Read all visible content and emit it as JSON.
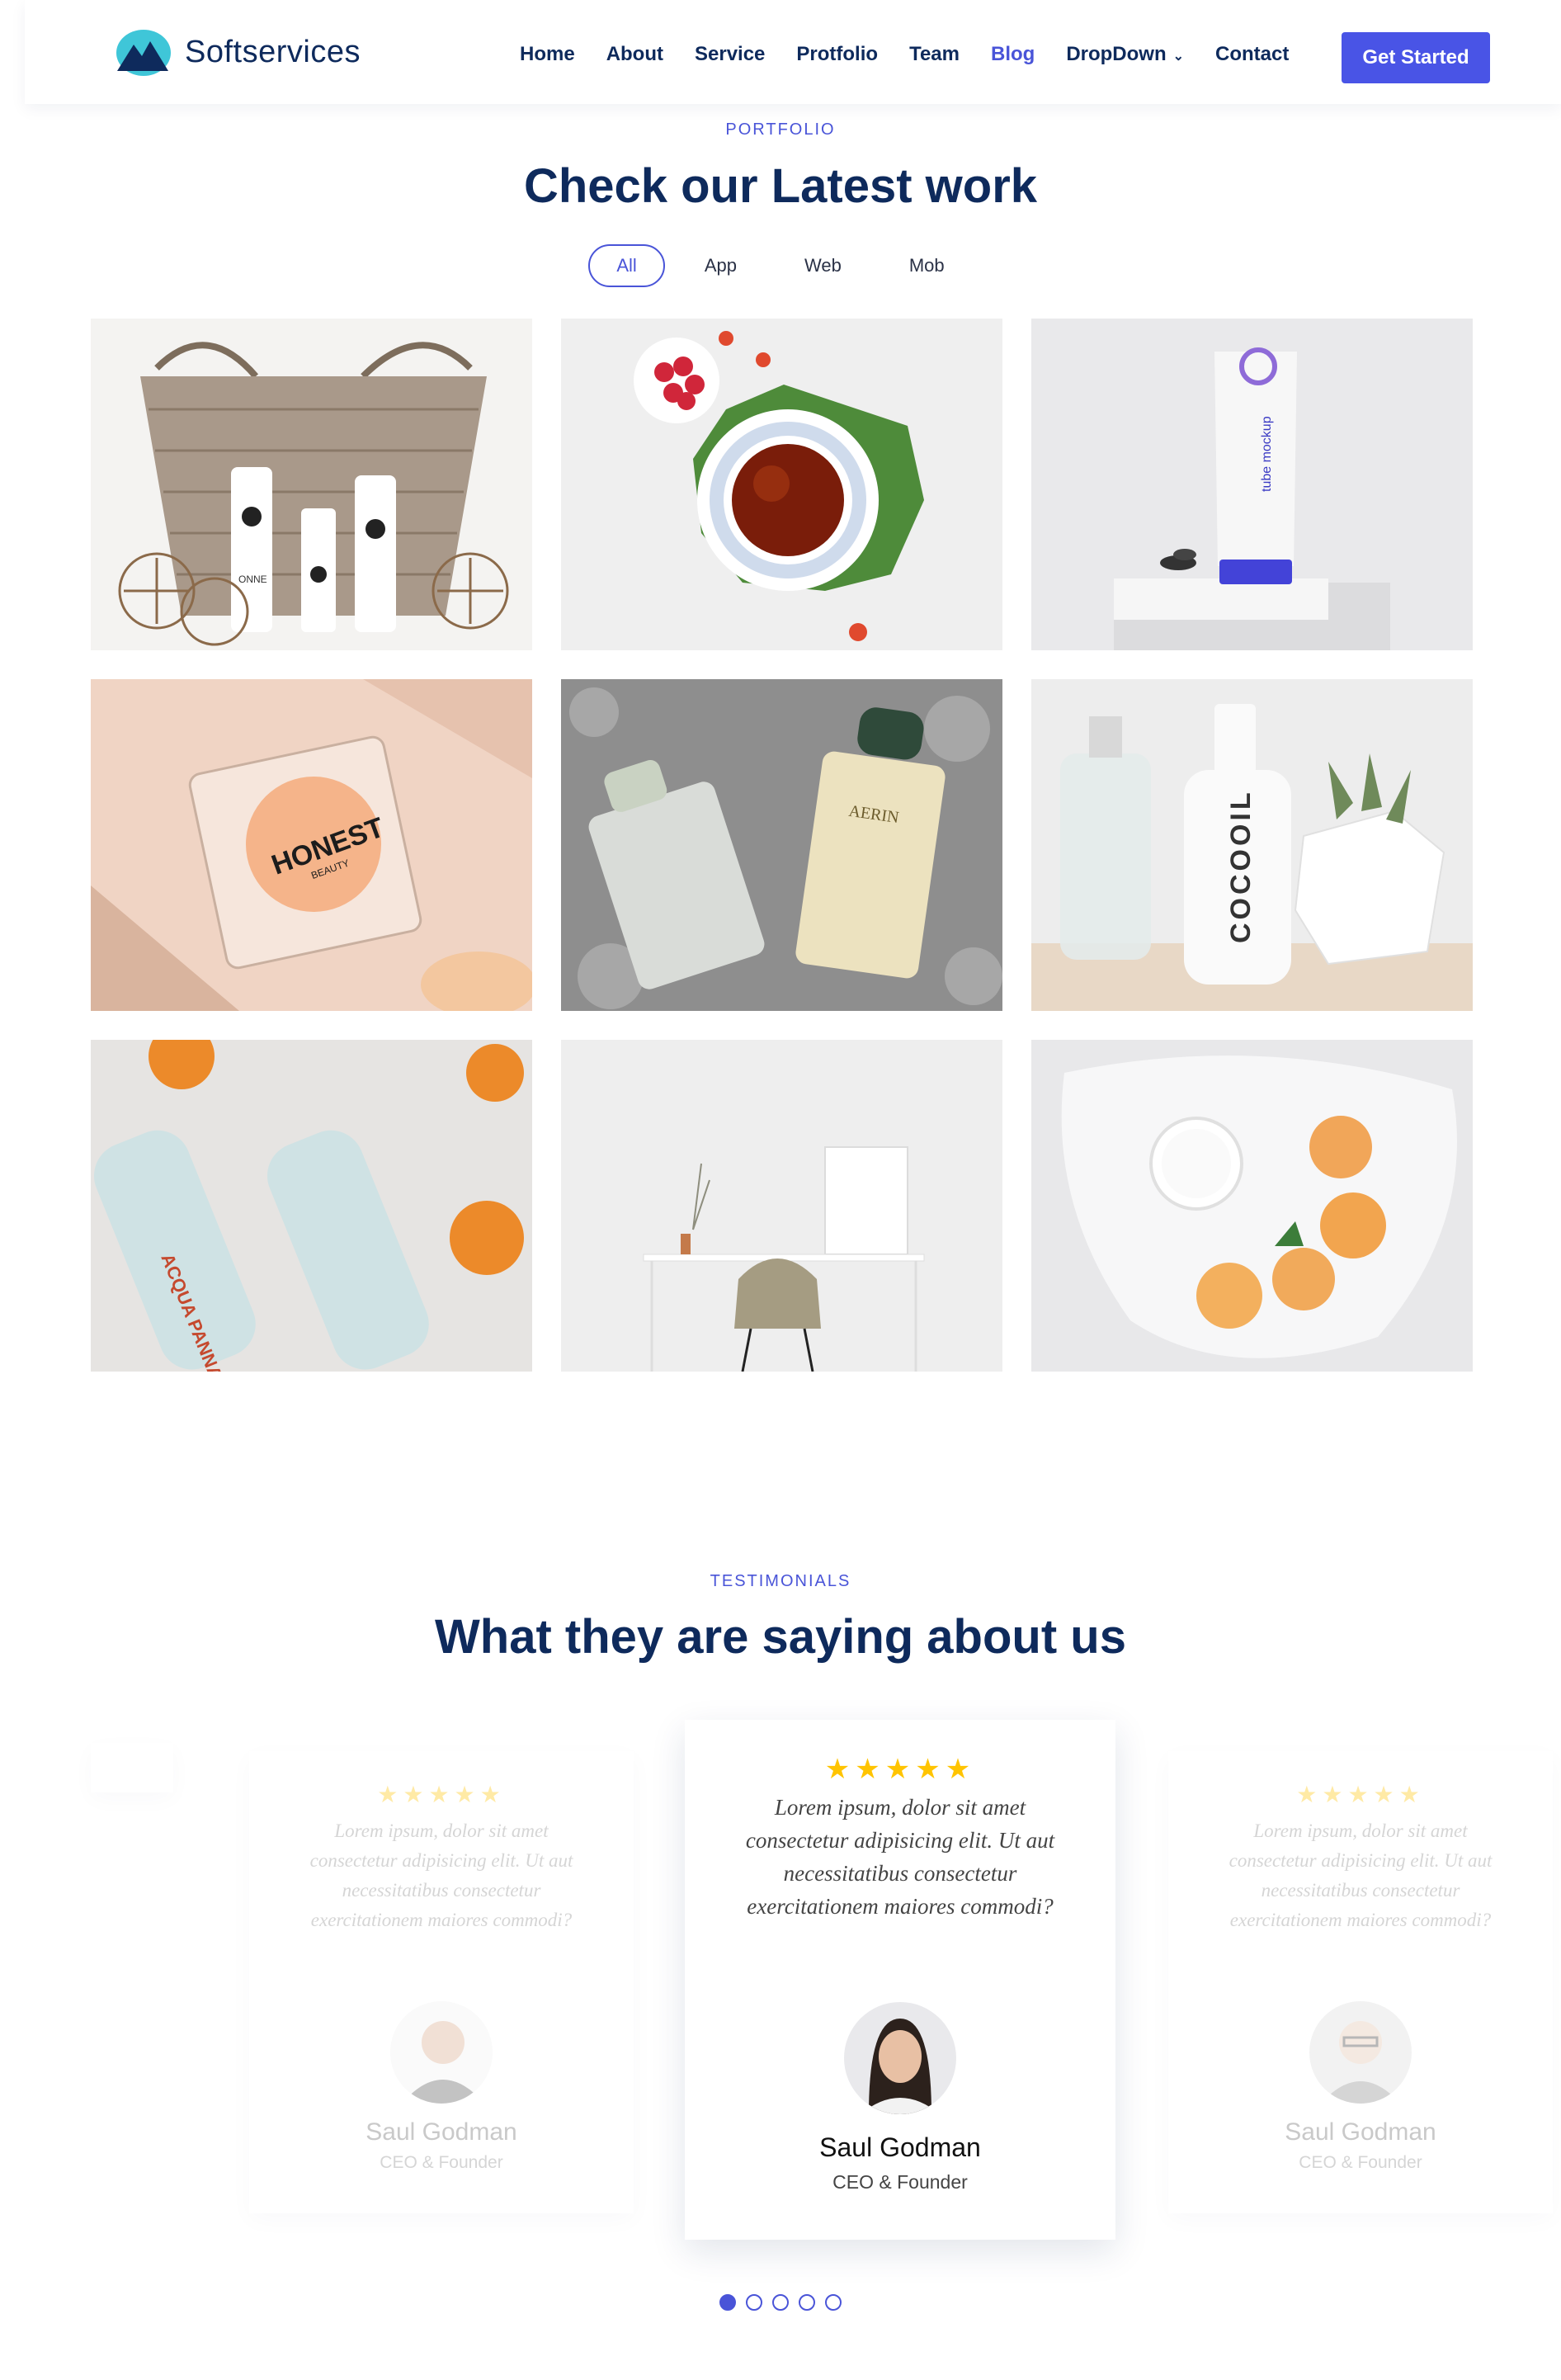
{
  "brand": {
    "name": "Softservices"
  },
  "nav": {
    "items": [
      {
        "label": "Home"
      },
      {
        "label": "About"
      },
      {
        "label": "Service"
      },
      {
        "label": "Protfolio"
      },
      {
        "label": "Team"
      },
      {
        "label": "Blog",
        "active": true
      },
      {
        "label": "DropDown",
        "dropdown": true
      },
      {
        "label": "Contact"
      }
    ],
    "cta": "Get Started"
  },
  "portfolio": {
    "eyebrow": "PORTFOLIO",
    "title": "Check our Latest work",
    "filters": [
      "All",
      "App",
      "Web",
      "Mob"
    ],
    "active_filter": "All",
    "items": [
      {
        "image": "basket-bottles",
        "text": "ONNE"
      },
      {
        "image": "tea-cup-raspberries"
      },
      {
        "image": "tube-mockup",
        "text": "tube mockup"
      },
      {
        "image": "honest-compact",
        "text": "HONEST",
        "text2": "BEAUTY"
      },
      {
        "image": "aerin-perfume",
        "text": "AERIN"
      },
      {
        "image": "cocooil-bottle",
        "text": "COCOOIL"
      },
      {
        "image": "acqua-panna-bottles",
        "text": "ACQUA PANNA"
      },
      {
        "image": "desk-chair"
      },
      {
        "image": "plate-pastries"
      }
    ]
  },
  "testimonials": {
    "eyebrow": "TESTIMONIALS",
    "title": "What they are saying about us",
    "cards": [
      {
        "stars": "★★★★★",
        "quote": "Lorem ipsum, dolor sit amet consectetur adipisicing elit. Ut aut necessitatibus consectetur exercitationem maiores commodi?",
        "name": "Saul Godman",
        "role": "CEO & Founder",
        "avatar": "man-smiling"
      },
      {
        "stars": "★★★★★",
        "quote": "Lorem ipsum, dolor sit amet consectetur adipisicing elit. Ut aut necessitatibus consectetur exercitationem maiores commodi?",
        "name": "Saul Godman",
        "role": "CEO & Founder",
        "avatar": "woman"
      },
      {
        "stars": "★★★★★",
        "quote": "Lorem ipsum, dolor sit amet consectetur adipisicing elit. Ut aut necessitatibus consectetur exercitationem maiores commodi?",
        "name": "Saul Godman",
        "role": "CEO & Founder",
        "avatar": "man-glasses"
      }
    ],
    "pagination": {
      "count": 5,
      "active": 1
    }
  },
  "colors": {
    "accent": "#4954d8",
    "navy": "#0e2a5c",
    "star": "#ffc400"
  }
}
